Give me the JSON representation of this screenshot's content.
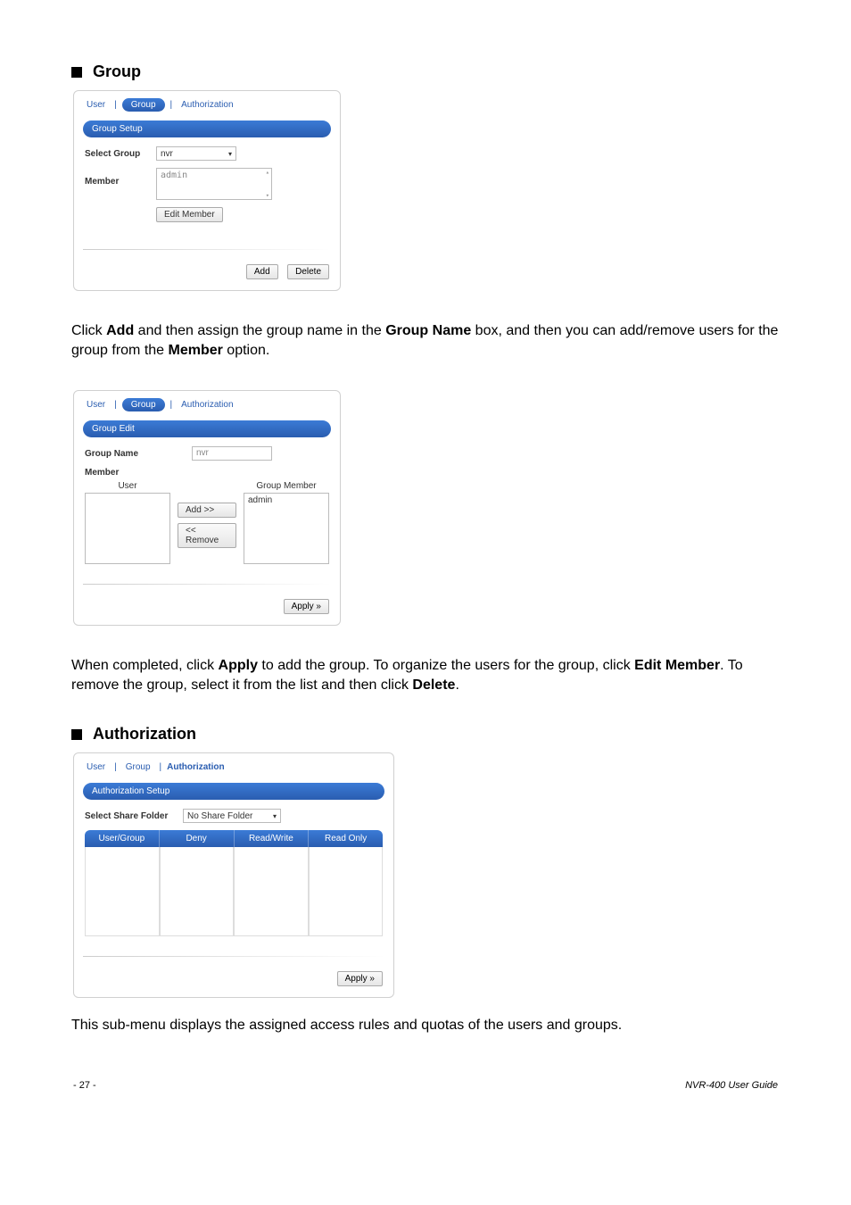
{
  "sections": {
    "group": {
      "title": "Group"
    },
    "authorization": {
      "title": "Authorization"
    }
  },
  "common_tabs": {
    "user": "User",
    "group": "Group",
    "authorization": "Authorization",
    "sep": "|"
  },
  "panel1": {
    "subhead": "Group Setup",
    "select_group_label": "Select Group",
    "select_group_value": "nvr",
    "member_label": "Member",
    "member_value": "admin",
    "edit_member_btn": "Edit Member",
    "add_btn": "Add",
    "delete_btn": "Delete"
  },
  "para1_a": "Click ",
  "para1_b": "Add",
  "para1_c": " and then assign the group name in the ",
  "para1_d": "Group Name",
  "para1_e": " box, and then you can add/remove users for the group from the ",
  "para1_f": "Member",
  "para1_g": " option.",
  "panel2": {
    "subhead": "Group Edit",
    "group_name_label": "Group Name",
    "group_name_value": "nvr",
    "member_label": "Member",
    "user_col": "User",
    "group_member_col": "Group Member",
    "group_member_value": "admin",
    "add_btn": "Add >>",
    "remove_btn": "<< Remove",
    "apply_btn": "Apply »"
  },
  "para2_a": "When completed, click ",
  "para2_b": "Apply",
  "para2_c": " to add the group. To organize the users for the group, click ",
  "para2_d": "Edit Member",
  "para2_e": ". To remove the group, select it from the list and then click ",
  "para2_f": "Delete",
  "para2_g": ".",
  "panel3": {
    "subhead": "Authorization Setup",
    "select_folder_label": "Select Share Folder",
    "select_folder_value": "No Share Folder",
    "col_user_group": "User/Group",
    "col_deny": "Deny",
    "col_rw": "Read/Write",
    "col_ro": "Read Only",
    "apply_btn": "Apply »"
  },
  "para3": "This sub-menu displays the assigned access rules and quotas of the users and groups.",
  "footer": {
    "page": "- 27 -",
    "guide": "NVR-400 User Guide"
  }
}
